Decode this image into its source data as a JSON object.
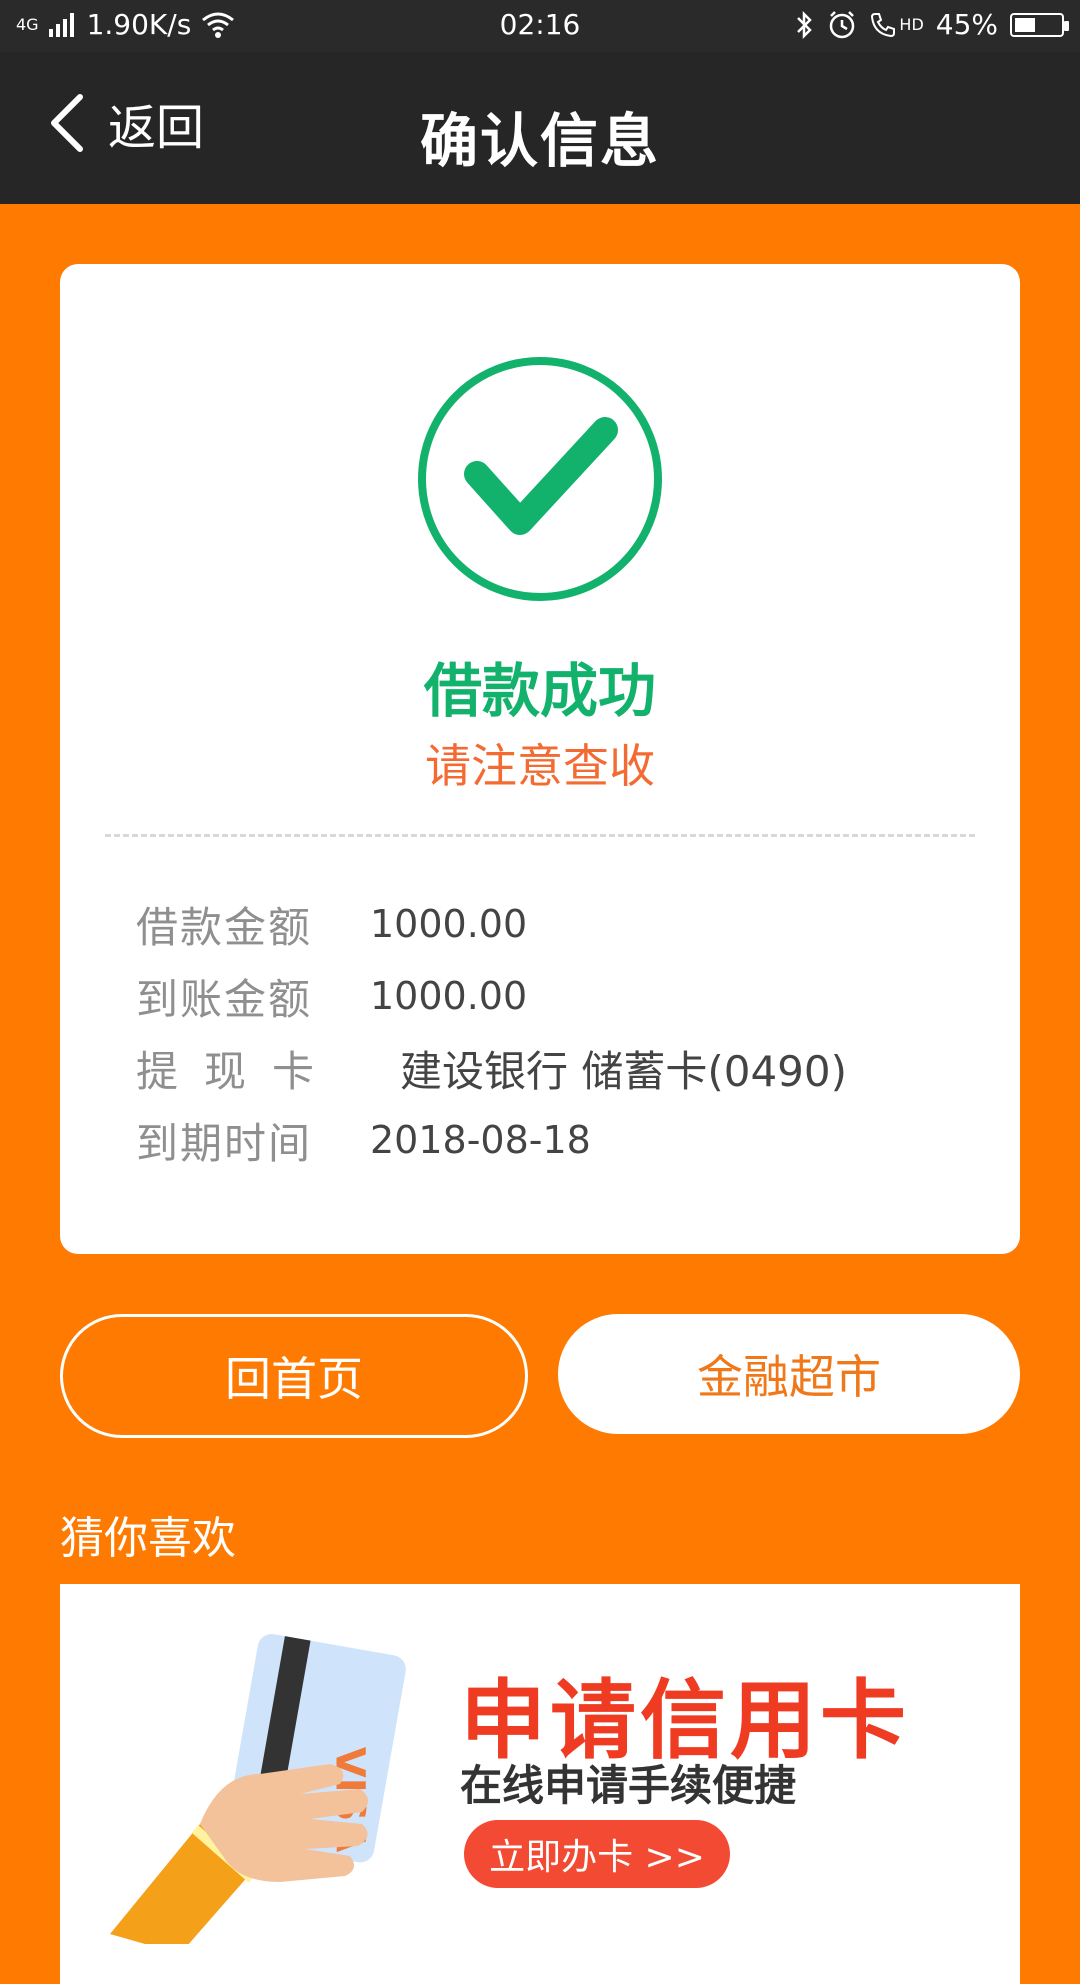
{
  "status_bar": {
    "network": "4G",
    "speed": "1.90K/s",
    "time": "02:16",
    "battery": "45%",
    "hd_label": "HD",
    "battery_level": 0.45
  },
  "header": {
    "back_label": "返回",
    "title": "确认信息"
  },
  "result": {
    "title": "借款成功",
    "subtitle": "请注意查收"
  },
  "details": [
    {
      "label": "借款金额",
      "value": "1000.00"
    },
    {
      "label": "到账金额",
      "value": "1000.00"
    },
    {
      "label": "提现卡",
      "value": "建设银行 储蓄卡(0490)"
    },
    {
      "label": "到期时间",
      "value": "2018-08-18"
    }
  ],
  "buttons": {
    "home": "回首页",
    "market": "金融超市"
  },
  "recommend": {
    "title": "猜你喜欢",
    "banner": {
      "title": "申请信用卡",
      "subtitle": "在线申请手续便捷",
      "cta": "立即办卡 >>",
      "card_brand": "VISA"
    }
  },
  "colors": {
    "primary": "#ff7a00",
    "success": "#12b26d",
    "accent": "#f36b32",
    "banner_red": "#ee3b21"
  }
}
